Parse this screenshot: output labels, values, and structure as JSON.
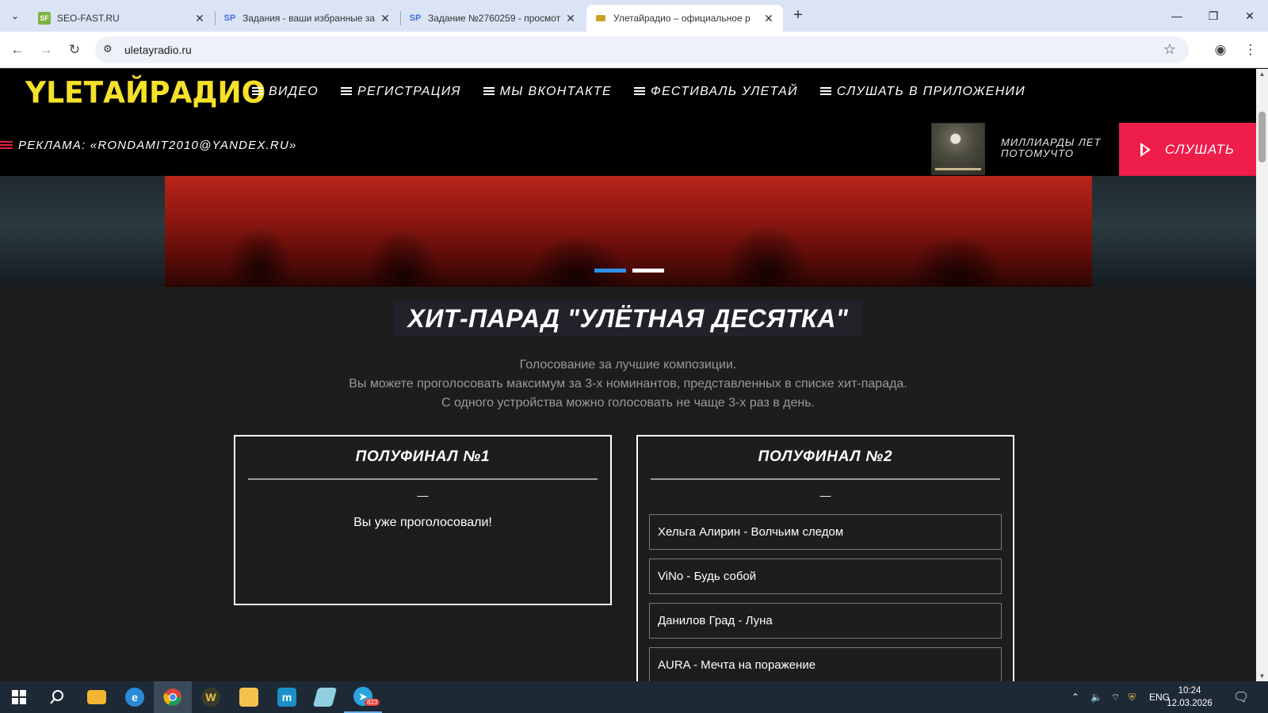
{
  "browser": {
    "tabs": [
      {
        "title": "SEO-FAST.RU",
        "favicon": "SF",
        "favicon_color": "#7cb342"
      },
      {
        "title": "Задания - ваши избранные за",
        "favicon": "SP",
        "favicon_color": "#3f6fd8"
      },
      {
        "title": "Задание №2760259 - просмот",
        "favicon": "SP",
        "favicon_color": "#3f6fd8"
      },
      {
        "title": "Улетайрадио – официальное р",
        "favicon": "radio",
        "favicon_color": "#c9a227"
      }
    ],
    "active_tab_index": 3,
    "url": "uletayradio.ru"
  },
  "site": {
    "logo": "YLETАЙРАДИО",
    "menu": [
      {
        "label": "ВИДЕО"
      },
      {
        "label": "РЕГИСТРАЦИЯ"
      },
      {
        "label": "МЫ ВКОНТАКТЕ"
      },
      {
        "label": "ФЕСТИВАЛЬ УЛЕТАЙ"
      },
      {
        "label": "СЛУШАТЬ В ПРИЛОЖЕНИИ"
      }
    ],
    "ad_text": "РЕКЛАМА: «RONDAMIT2010@YANDEX.RU»",
    "now_playing": {
      "line1": "МИЛЛИАРДЫ ЛЕТ",
      "line2": "ПОТОМУЧТО"
    },
    "listen_label": "СЛУШАТЬ",
    "accent_color": "#ee1d4a",
    "logo_color": "#f5e12a",
    "slider": {
      "slides": 2,
      "active": 0,
      "active_color": "#2f8fe8",
      "inactive_color": "#ffffff"
    }
  },
  "hitparade": {
    "title": "ХИТ-ПАРАД \"УЛЁТНАЯ ДЕСЯТКА\"",
    "description": [
      "Голосование за лучшие композиции.",
      "Вы можете проголосовать максимум за 3-х номинантов, представленных в списке хит-парада.",
      "С одного устройства можно голосовать не чаще 3-х раз в день."
    ],
    "semifinal1": {
      "title": "ПОЛУФИНАЛ №1",
      "dash": "—",
      "message": "Вы уже проголосовали!"
    },
    "semifinal2": {
      "title": "ПОЛУФИНАЛ №2",
      "dash": "—",
      "options": [
        "Хельга Алирин - Волчьим следом",
        "ViNo - Будь собой",
        "Данилов Град - Луна",
        "AURA - Мечта на поражение"
      ]
    }
  },
  "taskbar": {
    "apps": [
      "start",
      "search",
      "file-explorer",
      "edge",
      "chrome",
      "app-w",
      "notes",
      "maxthon",
      "pen-app",
      "telegram"
    ],
    "telegram_badge": "823",
    "language": "ENG",
    "time": "10:24",
    "date": "12.03.2026"
  }
}
